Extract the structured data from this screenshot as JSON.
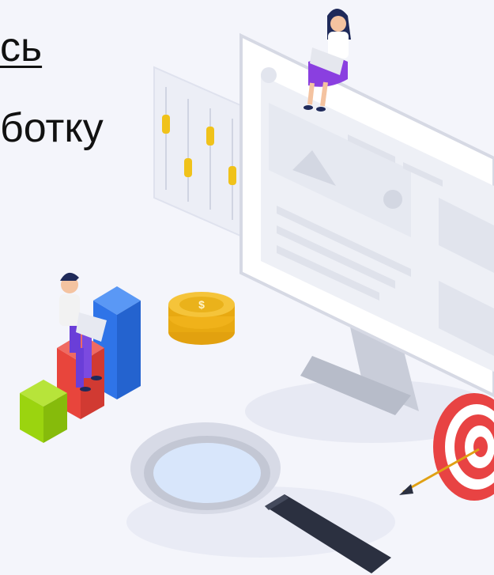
{
  "text": {
    "line1": "сь",
    "line2": "ботку"
  },
  "colors": {
    "background": "#f4f5fb",
    "bar_blue": "#2f74e8",
    "bar_red": "#e8453c",
    "bar_green": "#9bd40f",
    "coin_gold": "#f0b21a",
    "target_red": "#e84343",
    "magnifier_handle": "#2b3040"
  },
  "icons": [
    "monitor-illustration",
    "slider-panel",
    "person-on-monitor",
    "coin-stack",
    "bar-chart",
    "person-on-chart",
    "magnifier",
    "target-with-arrow"
  ]
}
